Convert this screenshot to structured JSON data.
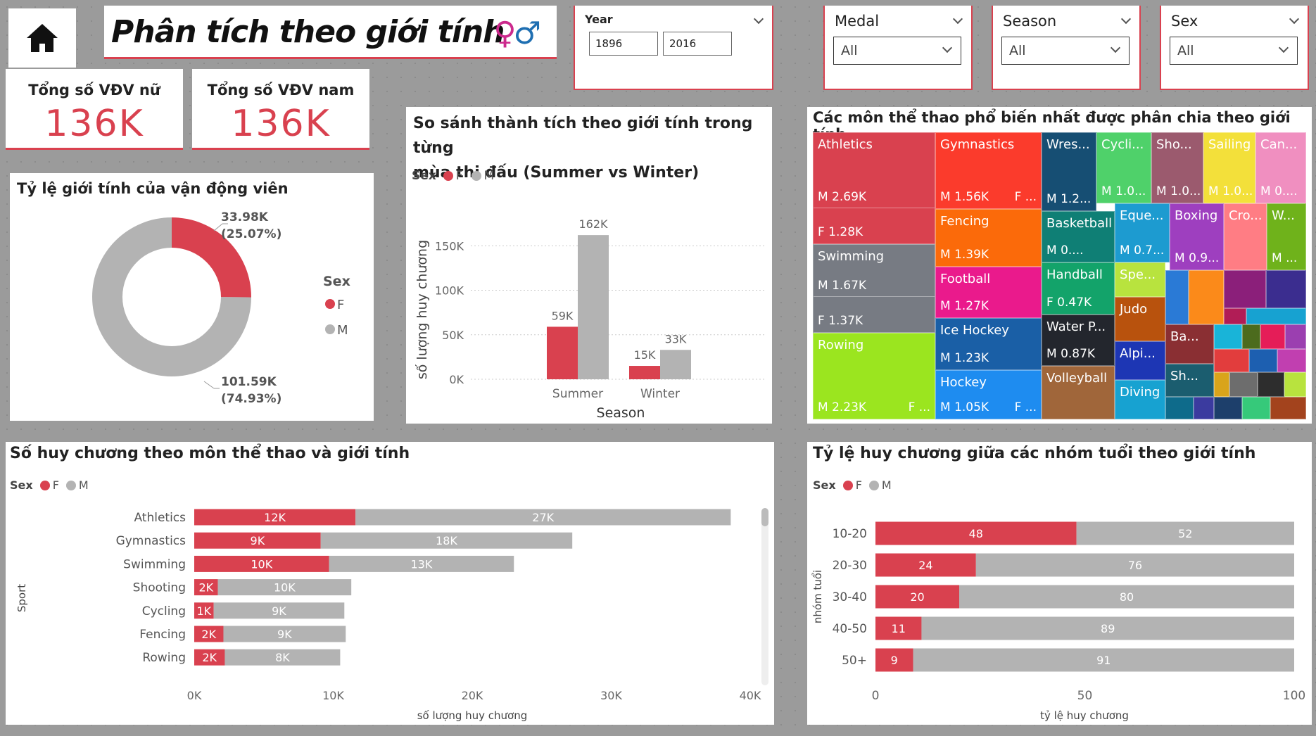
{
  "header": {
    "title": "Phân tích theo giới tính",
    "home_icon": "home-icon",
    "gender_icons": [
      "♀",
      "♂"
    ]
  },
  "slicers": {
    "year": {
      "label": "Year",
      "from": "1896",
      "to": "2016"
    },
    "medal": {
      "label": "Medal",
      "value": "All"
    },
    "season": {
      "label": "Season",
      "value": "All"
    },
    "sex": {
      "label": "Sex",
      "value": "All"
    }
  },
  "kpis": [
    {
      "label": "Tổng số VĐV nữ",
      "value": "136K"
    },
    {
      "label": "Tổng số VĐV nam",
      "value": "136K"
    }
  ],
  "colors": {
    "female": "#d9414f",
    "male": "#b3b3b3",
    "accent": "#d9414f"
  },
  "donut": {
    "title": "Tỷ lệ giới tính của vận động viên",
    "legend_title": "Sex",
    "slices": [
      {
        "name": "F",
        "value": 33.98,
        "label": "33.98K",
        "pct": "(25.07%)"
      },
      {
        "name": "M",
        "value": 101.59,
        "label": "101.59K",
        "pct": "(74.93%)"
      }
    ]
  },
  "season_chart": {
    "title_line1": "So sánh thành tích theo giới tính trong từng",
    "title_line2": "mùa thi đấu (Summer vs Winter)",
    "legend_title": "Sex",
    "legend": [
      "F",
      "M"
    ],
    "ylabel": "số lượng huy chương",
    "xlabel": "Season",
    "yticks": [
      "0K",
      "50K",
      "100K",
      "150K"
    ],
    "ylim": [
      0,
      170000
    ],
    "categories": [
      "Summer",
      "Winter"
    ],
    "series": [
      {
        "name": "F",
        "values": [
          59000,
          15000
        ],
        "labels": [
          "59K",
          "15K"
        ]
      },
      {
        "name": "M",
        "values": [
          162000,
          33000
        ],
        "labels": [
          "162K",
          "33K"
        ]
      }
    ]
  },
  "treemap": {
    "title": "Các môn thể thao phổ biến nhất được phân chia theo giới tính",
    "cells": [
      {
        "name": "Athletics",
        "m": "M 2.69K",
        "f": "",
        "color": "#d9414f"
      },
      {
        "name": "",
        "m": "F 1.28K",
        "f": "",
        "color": "#d9414f"
      },
      {
        "name": "Swimming",
        "m": "M 1.67K",
        "f": "",
        "color": "#777b83"
      },
      {
        "name": "",
        "m": "F 1.37K",
        "f": "",
        "color": "#777b83"
      },
      {
        "name": "Rowing",
        "m": "M 2.23K",
        "f": "F ...",
        "color": "#9be51f"
      },
      {
        "name": "Gymnastics",
        "m": "M 1.56K",
        "f": "F ...",
        "color": "#fb3b2c"
      },
      {
        "name": "Fencing",
        "m": "M 1.39K",
        "f": "",
        "color": "#fb6a0a"
      },
      {
        "name": "Football",
        "m": "M 1.27K",
        "f": "",
        "color": "#ea1a8c"
      },
      {
        "name": "Ice Hockey",
        "m": "M 1.23K",
        "f": "",
        "color": "#1a5fa6"
      },
      {
        "name": "Hockey",
        "m": "M 1.05K",
        "f": "F ...",
        "color": "#1e8cf0"
      },
      {
        "name": "Wres...",
        "m": "M 1.2...",
        "f": "",
        "color": "#164e73"
      },
      {
        "name": "Cycli...",
        "m": "M 1.0...",
        "f": "",
        "color": "#4fd16a"
      },
      {
        "name": "Sho...",
        "m": "M 1.0...",
        "f": "",
        "color": "#9b5a6e"
      },
      {
        "name": "Sailing",
        "m": "M 1.0...",
        "f": "",
        "color": "#f3e03a"
      },
      {
        "name": "Can...",
        "m": "M 0....",
        "f": "",
        "color": "#f08fc0"
      },
      {
        "name": "Basketball",
        "m": "M 0....",
        "f": "",
        "color": "#0f7f75"
      },
      {
        "name": "Eque...",
        "m": "M 0.7...",
        "f": "",
        "color": "#1d9bd0"
      },
      {
        "name": "Boxing",
        "m": "M 0.9...",
        "f": "",
        "color": "#9e3fbf"
      },
      {
        "name": "Cro...",
        "m": "",
        "f": "",
        "color": "#ff7d84"
      },
      {
        "name": "W...",
        "m": "M ...",
        "f": "",
        "color": "#6fb21b"
      },
      {
        "name": "Handball",
        "m": "F 0.47K",
        "f": "",
        "color": "#13a36a"
      },
      {
        "name": "Water P...",
        "m": "M 0.87K",
        "f": "",
        "color": "#23262d"
      },
      {
        "name": "Volleyball",
        "m": "",
        "f": "",
        "color": "#a0663a"
      },
      {
        "name": "Spe...",
        "m": "",
        "f": "",
        "color": "#b8e33e"
      },
      {
        "name": "Judo",
        "m": "",
        "f": "",
        "color": "#b8520d"
      },
      {
        "name": "Alpi...",
        "m": "",
        "f": "",
        "color": "#1d36b4"
      },
      {
        "name": "Diving",
        "m": "",
        "f": "",
        "color": "#17a2d1"
      },
      {
        "name": "Ba...",
        "m": "",
        "f": "",
        "color": "#8a2f33"
      },
      {
        "name": "Sh...",
        "m": "",
        "f": "",
        "color": "#1b5d6f"
      }
    ]
  },
  "sport_chart": {
    "title": "Số huy chương theo môn thể thao và giới tính",
    "legend_title": "Sex",
    "legend": [
      "F",
      "M"
    ],
    "ylabel": "Sport",
    "xlabel": "số lượng huy chương",
    "xticks": [
      "0K",
      "10K",
      "20K",
      "30K",
      "40K"
    ],
    "xlim": [
      0,
      40000
    ],
    "categories": [
      "Athletics",
      "Gymnastics",
      "Swimming",
      "Shooting",
      "Cycling",
      "Fencing",
      "Rowing"
    ],
    "series": [
      {
        "name": "F",
        "values": [
          11600,
          9100,
          9700,
          1700,
          1400,
          2100,
          2200
        ],
        "labels": [
          "12K",
          "9K",
          "10K",
          "2K",
          "1K",
          "2K",
          "2K"
        ]
      },
      {
        "name": "M",
        "values": [
          27000,
          18100,
          13300,
          9600,
          9400,
          8800,
          8300
        ],
        "labels": [
          "27K",
          "18K",
          "13K",
          "10K",
          "9K",
          "9K",
          "8K"
        ]
      }
    ]
  },
  "age_chart": {
    "title": "Tỷ lệ huy chương giữa các nhóm tuổi theo giới tính",
    "legend_title": "Sex",
    "legend": [
      "F",
      "M"
    ],
    "ylabel": "nhóm tuổi",
    "xlabel": "tỷ lệ huy chương",
    "xticks": [
      "0",
      "50",
      "100"
    ],
    "xlim": [
      0,
      100
    ],
    "categories": [
      "10-20",
      "20-30",
      "30-40",
      "40-50",
      "50+"
    ],
    "series": [
      {
        "name": "F",
        "values": [
          48,
          24,
          20,
          11,
          9
        ]
      },
      {
        "name": "M",
        "values": [
          52,
          76,
          80,
          89,
          91
        ]
      }
    ]
  },
  "chart_data": [
    {
      "type": "pie",
      "title": "Tỷ lệ giới tính của vận động viên",
      "categories": [
        "F",
        "M"
      ],
      "values": [
        33980,
        101590
      ]
    },
    {
      "type": "bar",
      "title": "So sánh thành tích theo giới tính trong từng mùa thi đấu (Summer vs Winter)",
      "categories": [
        "Summer",
        "Winter"
      ],
      "series": [
        {
          "name": "F",
          "values": [
            59000,
            15000
          ]
        },
        {
          "name": "M",
          "values": [
            162000,
            33000
          ]
        }
      ],
      "xlabel": "Season",
      "ylabel": "số lượng huy chương",
      "ylim": [
        0,
        170000
      ]
    },
    {
      "type": "bar",
      "title": "Số huy chương theo môn thể thao và giới tính",
      "categories": [
        "Athletics",
        "Gymnastics",
        "Swimming",
        "Shooting",
        "Cycling",
        "Fencing",
        "Rowing"
      ],
      "series": [
        {
          "name": "F",
          "values": [
            11600,
            9100,
            9700,
            1700,
            1400,
            2100,
            2200
          ]
        },
        {
          "name": "M",
          "values": [
            27000,
            18100,
            13300,
            9600,
            9400,
            8800,
            8300
          ]
        }
      ],
      "xlabel": "số lượng huy chương",
      "ylabel": "Sport",
      "xlim": [
        0,
        40000
      ]
    },
    {
      "type": "bar",
      "title": "Tỷ lệ huy chương giữa các nhóm tuổi theo giới tính",
      "categories": [
        "10-20",
        "20-30",
        "30-40",
        "40-50",
        "50+"
      ],
      "series": [
        {
          "name": "F",
          "values": [
            48,
            24,
            20,
            11,
            9
          ]
        },
        {
          "name": "M",
          "values": [
            52,
            76,
            80,
            89,
            91
          ]
        }
      ],
      "xlabel": "tỷ lệ huy chương",
      "ylabel": "nhóm tuổi",
      "xlim": [
        0,
        100
      ]
    }
  ]
}
